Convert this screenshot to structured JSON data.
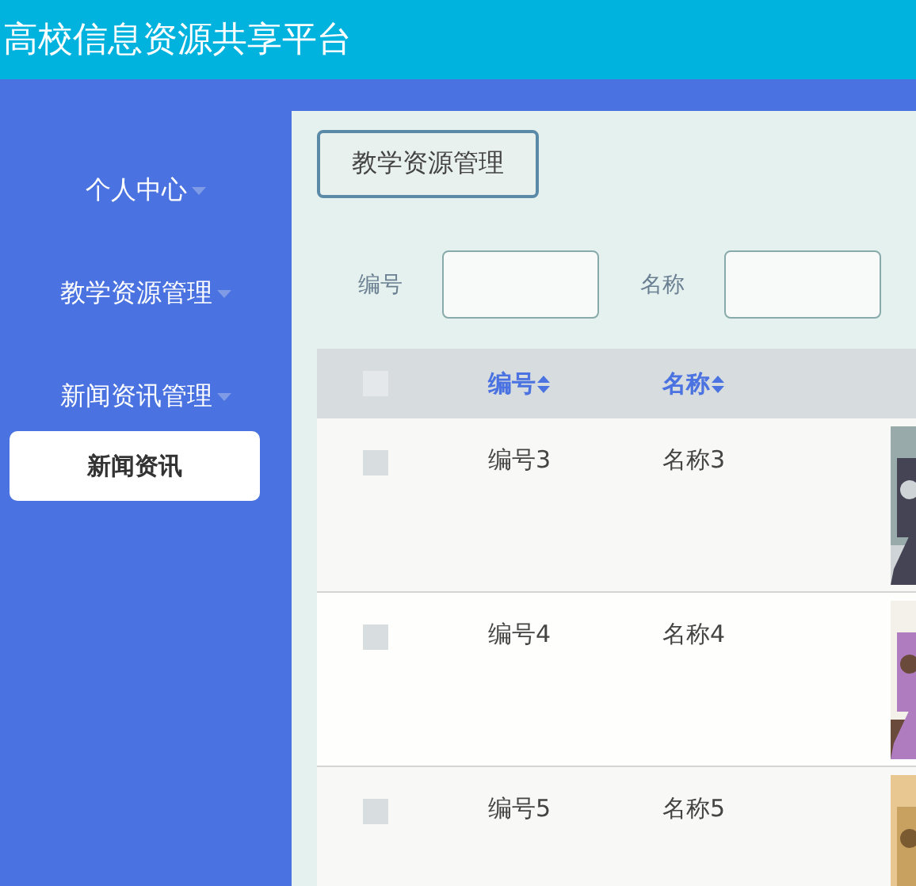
{
  "header": {
    "title": "高校信息资源共享平台"
  },
  "sidebar": {
    "items": [
      {
        "label": "个人中心"
      },
      {
        "label": "教学资源管理"
      },
      {
        "label": "新闻资讯管理",
        "children": [
          {
            "label": "新闻资讯"
          }
        ]
      }
    ]
  },
  "main": {
    "breadcrumb_button": "教学资源管理",
    "search": [
      {
        "label": "编号"
      },
      {
        "label": "名称"
      }
    ],
    "table": {
      "select_all_checked": false,
      "columns": [
        "编号",
        "名称"
      ],
      "rows": [
        {
          "checked": false,
          "code": "编号3",
          "name": "名称3"
        },
        {
          "checked": false,
          "code": "编号4",
          "name": "名称4"
        },
        {
          "checked": false,
          "code": "编号5",
          "name": "名称5"
        }
      ]
    }
  }
}
